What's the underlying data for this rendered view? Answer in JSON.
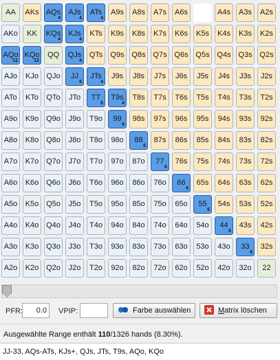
{
  "matrix": {
    "rows": [
      [
        {
          "l": "AA",
          "k": "pair"
        },
        {
          "l": "AKs",
          "k": "suited"
        },
        {
          "l": "AQs",
          "k": "sel",
          "c": "4"
        },
        {
          "l": "AJs",
          "k": "sel",
          "c": "4"
        },
        {
          "l": "ATs",
          "k": "sel",
          "c": "4"
        },
        {
          "l": "A9s",
          "k": "suited"
        },
        {
          "l": "A8s",
          "k": "suited"
        },
        {
          "l": "A7s",
          "k": "suited"
        },
        {
          "l": "A6s",
          "k": "suited"
        },
        {
          "l": "",
          "k": "empty"
        },
        {
          "l": "A4s",
          "k": "suited"
        },
        {
          "l": "A3s",
          "k": "suited"
        },
        {
          "l": "A2s",
          "k": "suited"
        }
      ],
      [
        {
          "l": "AKo",
          "k": "offsuit"
        },
        {
          "l": "KK",
          "k": "pair"
        },
        {
          "l": "KQs",
          "k": "sel",
          "c": "4"
        },
        {
          "l": "KJs",
          "k": "sel",
          "c": "4"
        },
        {
          "l": "KTs",
          "k": "suited"
        },
        {
          "l": "K9s",
          "k": "suited"
        },
        {
          "l": "K8s",
          "k": "suited"
        },
        {
          "l": "K7s",
          "k": "suited"
        },
        {
          "l": "K6s",
          "k": "suited"
        },
        {
          "l": "K5s",
          "k": "suited"
        },
        {
          "l": "K4s",
          "k": "suited"
        },
        {
          "l": "K3s",
          "k": "suited"
        },
        {
          "l": "K2s",
          "k": "suited"
        }
      ],
      [
        {
          "l": "AQo",
          "k": "sel",
          "c": "12"
        },
        {
          "l": "KQo",
          "k": "sel",
          "c": "12"
        },
        {
          "l": "QQ",
          "k": "pair"
        },
        {
          "l": "QJs",
          "k": "sel",
          "c": "4"
        },
        {
          "l": "QTs",
          "k": "suited"
        },
        {
          "l": "Q9s",
          "k": "suited"
        },
        {
          "l": "Q8s",
          "k": "suited"
        },
        {
          "l": "Q7s",
          "k": "suited"
        },
        {
          "l": "Q6s",
          "k": "suited"
        },
        {
          "l": "Q5s",
          "k": "suited"
        },
        {
          "l": "Q4s",
          "k": "suited"
        },
        {
          "l": "Q3s",
          "k": "suited"
        },
        {
          "l": "Q2s",
          "k": "suited"
        }
      ],
      [
        {
          "l": "AJo",
          "k": "offsuit"
        },
        {
          "l": "KJo",
          "k": "offsuit"
        },
        {
          "l": "QJo",
          "k": "offsuit"
        },
        {
          "l": "JJ",
          "k": "sel",
          "c": "6"
        },
        {
          "l": "JTs",
          "k": "sel",
          "c": "4"
        },
        {
          "l": "J9s",
          "k": "suited"
        },
        {
          "l": "J8s",
          "k": "suited"
        },
        {
          "l": "J7s",
          "k": "suited"
        },
        {
          "l": "J6s",
          "k": "suited"
        },
        {
          "l": "J5s",
          "k": "suited"
        },
        {
          "l": "J4s",
          "k": "suited"
        },
        {
          "l": "J3s",
          "k": "suited"
        },
        {
          "l": "J2s",
          "k": "suited"
        }
      ],
      [
        {
          "l": "ATo",
          "k": "offsuit"
        },
        {
          "l": "KTo",
          "k": "offsuit"
        },
        {
          "l": "QTo",
          "k": "offsuit"
        },
        {
          "l": "JTo",
          "k": "offsuit"
        },
        {
          "l": "TT",
          "k": "sel",
          "c": "6"
        },
        {
          "l": "T9s",
          "k": "sel",
          "c": "4"
        },
        {
          "l": "T8s",
          "k": "suited"
        },
        {
          "l": "T7s",
          "k": "suited"
        },
        {
          "l": "T6s",
          "k": "suited"
        },
        {
          "l": "T5s",
          "k": "suited"
        },
        {
          "l": "T4s",
          "k": "suited"
        },
        {
          "l": "T3s",
          "k": "suited"
        },
        {
          "l": "T2s",
          "k": "suited"
        }
      ],
      [
        {
          "l": "A9o",
          "k": "offsuit"
        },
        {
          "l": "K9o",
          "k": "offsuit"
        },
        {
          "l": "Q9o",
          "k": "offsuit"
        },
        {
          "l": "J9o",
          "k": "offsuit"
        },
        {
          "l": "T9o",
          "k": "offsuit"
        },
        {
          "l": "99",
          "k": "sel",
          "c": "6"
        },
        {
          "l": "98s",
          "k": "suited"
        },
        {
          "l": "97s",
          "k": "suited"
        },
        {
          "l": "96s",
          "k": "suited"
        },
        {
          "l": "95s",
          "k": "suited"
        },
        {
          "l": "94s",
          "k": "suited"
        },
        {
          "l": "93s",
          "k": "suited"
        },
        {
          "l": "92s",
          "k": "suited"
        }
      ],
      [
        {
          "l": "A8o",
          "k": "offsuit"
        },
        {
          "l": "K8o",
          "k": "offsuit"
        },
        {
          "l": "Q8o",
          "k": "offsuit"
        },
        {
          "l": "J8o",
          "k": "offsuit"
        },
        {
          "l": "T8o",
          "k": "offsuit"
        },
        {
          "l": "98o",
          "k": "offsuit"
        },
        {
          "l": "88",
          "k": "sel",
          "c": "6"
        },
        {
          "l": "87s",
          "k": "suited"
        },
        {
          "l": "86s",
          "k": "suited"
        },
        {
          "l": "85s",
          "k": "suited"
        },
        {
          "l": "84s",
          "k": "suited"
        },
        {
          "l": "83s",
          "k": "suited"
        },
        {
          "l": "82s",
          "k": "suited"
        }
      ],
      [
        {
          "l": "A7o",
          "k": "offsuit"
        },
        {
          "l": "K7o",
          "k": "offsuit"
        },
        {
          "l": "Q7o",
          "k": "offsuit"
        },
        {
          "l": "J7o",
          "k": "offsuit"
        },
        {
          "l": "T7o",
          "k": "offsuit"
        },
        {
          "l": "97o",
          "k": "offsuit"
        },
        {
          "l": "87o",
          "k": "offsuit"
        },
        {
          "l": "77",
          "k": "sel",
          "c": "6"
        },
        {
          "l": "76s",
          "k": "suited"
        },
        {
          "l": "75s",
          "k": "suited"
        },
        {
          "l": "74s",
          "k": "suited"
        },
        {
          "l": "73s",
          "k": "suited"
        },
        {
          "l": "72s",
          "k": "suited"
        }
      ],
      [
        {
          "l": "A6o",
          "k": "offsuit"
        },
        {
          "l": "K6o",
          "k": "offsuit"
        },
        {
          "l": "Q6o",
          "k": "offsuit"
        },
        {
          "l": "J6o",
          "k": "offsuit"
        },
        {
          "l": "T6o",
          "k": "offsuit"
        },
        {
          "l": "96o",
          "k": "offsuit"
        },
        {
          "l": "86o",
          "k": "offsuit"
        },
        {
          "l": "76o",
          "k": "offsuit"
        },
        {
          "l": "66",
          "k": "sel",
          "c": "6"
        },
        {
          "l": "65s",
          "k": "suited"
        },
        {
          "l": "64s",
          "k": "suited"
        },
        {
          "l": "63s",
          "k": "suited"
        },
        {
          "l": "62s",
          "k": "suited"
        }
      ],
      [
        {
          "l": "A5o",
          "k": "offsuit"
        },
        {
          "l": "K5o",
          "k": "offsuit"
        },
        {
          "l": "Q5o",
          "k": "offsuit"
        },
        {
          "l": "J5o",
          "k": "offsuit"
        },
        {
          "l": "T5o",
          "k": "offsuit"
        },
        {
          "l": "95o",
          "k": "offsuit"
        },
        {
          "l": "85o",
          "k": "offsuit"
        },
        {
          "l": "75o",
          "k": "offsuit"
        },
        {
          "l": "65o",
          "k": "offsuit"
        },
        {
          "l": "55",
          "k": "sel",
          "c": "6"
        },
        {
          "l": "54s",
          "k": "suited"
        },
        {
          "l": "53s",
          "k": "suited"
        },
        {
          "l": "52s",
          "k": "suited"
        }
      ],
      [
        {
          "l": "A4o",
          "k": "offsuit"
        },
        {
          "l": "K4o",
          "k": "offsuit"
        },
        {
          "l": "Q4o",
          "k": "offsuit"
        },
        {
          "l": "J4o",
          "k": "offsuit"
        },
        {
          "l": "T4o",
          "k": "offsuit"
        },
        {
          "l": "94o",
          "k": "offsuit"
        },
        {
          "l": "84o",
          "k": "offsuit"
        },
        {
          "l": "74o",
          "k": "offsuit"
        },
        {
          "l": "64o",
          "k": "offsuit"
        },
        {
          "l": "54o",
          "k": "offsuit"
        },
        {
          "l": "44",
          "k": "sel",
          "c": "6"
        },
        {
          "l": "43s",
          "k": "suited"
        },
        {
          "l": "42s",
          "k": "suited"
        }
      ],
      [
        {
          "l": "A3o",
          "k": "offsuit"
        },
        {
          "l": "K3o",
          "k": "offsuit"
        },
        {
          "l": "Q3o",
          "k": "offsuit"
        },
        {
          "l": "J3o",
          "k": "offsuit"
        },
        {
          "l": "T3o",
          "k": "offsuit"
        },
        {
          "l": "93o",
          "k": "offsuit"
        },
        {
          "l": "83o",
          "k": "offsuit"
        },
        {
          "l": "73o",
          "k": "offsuit"
        },
        {
          "l": "63o",
          "k": "offsuit"
        },
        {
          "l": "53o",
          "k": "offsuit"
        },
        {
          "l": "43o",
          "k": "offsuit"
        },
        {
          "l": "33",
          "k": "sel",
          "c": "6"
        },
        {
          "l": "32s",
          "k": "suited"
        }
      ],
      [
        {
          "l": "A2o",
          "k": "offsuit"
        },
        {
          "l": "K2o",
          "k": "offsuit"
        },
        {
          "l": "Q2o",
          "k": "offsuit"
        },
        {
          "l": "J2o",
          "k": "offsuit"
        },
        {
          "l": "T2o",
          "k": "offsuit"
        },
        {
          "l": "92o",
          "k": "offsuit"
        },
        {
          "l": "82o",
          "k": "offsuit"
        },
        {
          "l": "72o",
          "k": "offsuit"
        },
        {
          "l": "62o",
          "k": "offsuit"
        },
        {
          "l": "52o",
          "k": "offsuit"
        },
        {
          "l": "42o",
          "k": "offsuit"
        },
        {
          "l": "32o",
          "k": "offsuit"
        },
        {
          "l": "22",
          "k": "pair"
        }
      ]
    ]
  },
  "slider": {
    "value": 0
  },
  "controls": {
    "pfr_label": "PFR:",
    "pfr_value": "0.0",
    "vpip_label": "VPIP:",
    "vpip_value": "",
    "color_button_label": "Farbe auswählen",
    "clear_button_prefix": "",
    "clear_button_mnemonic": "M",
    "clear_button_rest": "atrix löschen"
  },
  "status": {
    "prefix": "Ausgewählte Range enthält ",
    "selected": "110",
    "rest": "/1326 hands (8.30%)."
  },
  "range_text": "JJ-33, AQs-ATs, KJs+, QJs, JTs, T9s, AQo, KQo",
  "colors": {
    "selected": "#5a9ce6",
    "pair": "#e4efd8",
    "suited": "#fde8c0",
    "offsuit": "#e9f0f8"
  }
}
